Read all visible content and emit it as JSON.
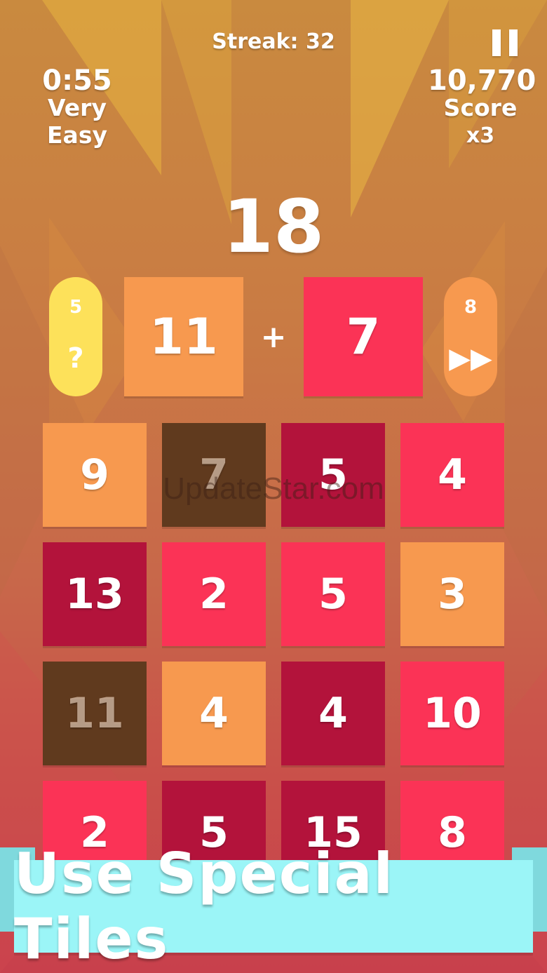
{
  "hud": {
    "streak": "Streak: 32",
    "timer": "0:55",
    "difficulty": "Very Easy",
    "score": "10,770",
    "score_label": "Score",
    "multiplier": "x3",
    "pause_icon": "pause-icon"
  },
  "target": "18",
  "selection": {
    "left_value": "11",
    "operator": "+",
    "right_value": "7"
  },
  "powerups": {
    "hint": {
      "count": "5",
      "icon": "?",
      "icon_name": "question-mark-icon",
      "color": "#fde15a"
    },
    "skip": {
      "count": "8",
      "icon": "▶▶",
      "icon_name": "fast-forward-icon",
      "color": "#f7994f"
    }
  },
  "grid": {
    "rows": [
      [
        {
          "value": "9",
          "color": "#f7994f"
        },
        {
          "value": "7",
          "color": "#603a1e",
          "dim": true
        },
        {
          "value": "5",
          "color": "#b3133b"
        },
        {
          "value": "4",
          "color": "#fb3356"
        }
      ],
      [
        {
          "value": "13",
          "color": "#b3133b"
        },
        {
          "value": "2",
          "color": "#fb3356"
        },
        {
          "value": "5",
          "color": "#fb3356"
        },
        {
          "value": "3",
          "color": "#f7994f"
        }
      ],
      [
        {
          "value": "11",
          "color": "#603a1e",
          "dim": true
        },
        {
          "value": "4",
          "color": "#f7994f"
        },
        {
          "value": "4",
          "color": "#b3133b"
        },
        {
          "value": "10",
          "color": "#fb3356"
        }
      ],
      [
        {
          "value": "2",
          "color": "#fb3356"
        },
        {
          "value": "5",
          "color": "#b3133b"
        },
        {
          "value": "15",
          "color": "#b3133b"
        },
        {
          "value": "8",
          "color": "#fb3356"
        }
      ]
    ]
  },
  "watermark": "UpdateStar.com",
  "banner": "Use Special Tiles"
}
